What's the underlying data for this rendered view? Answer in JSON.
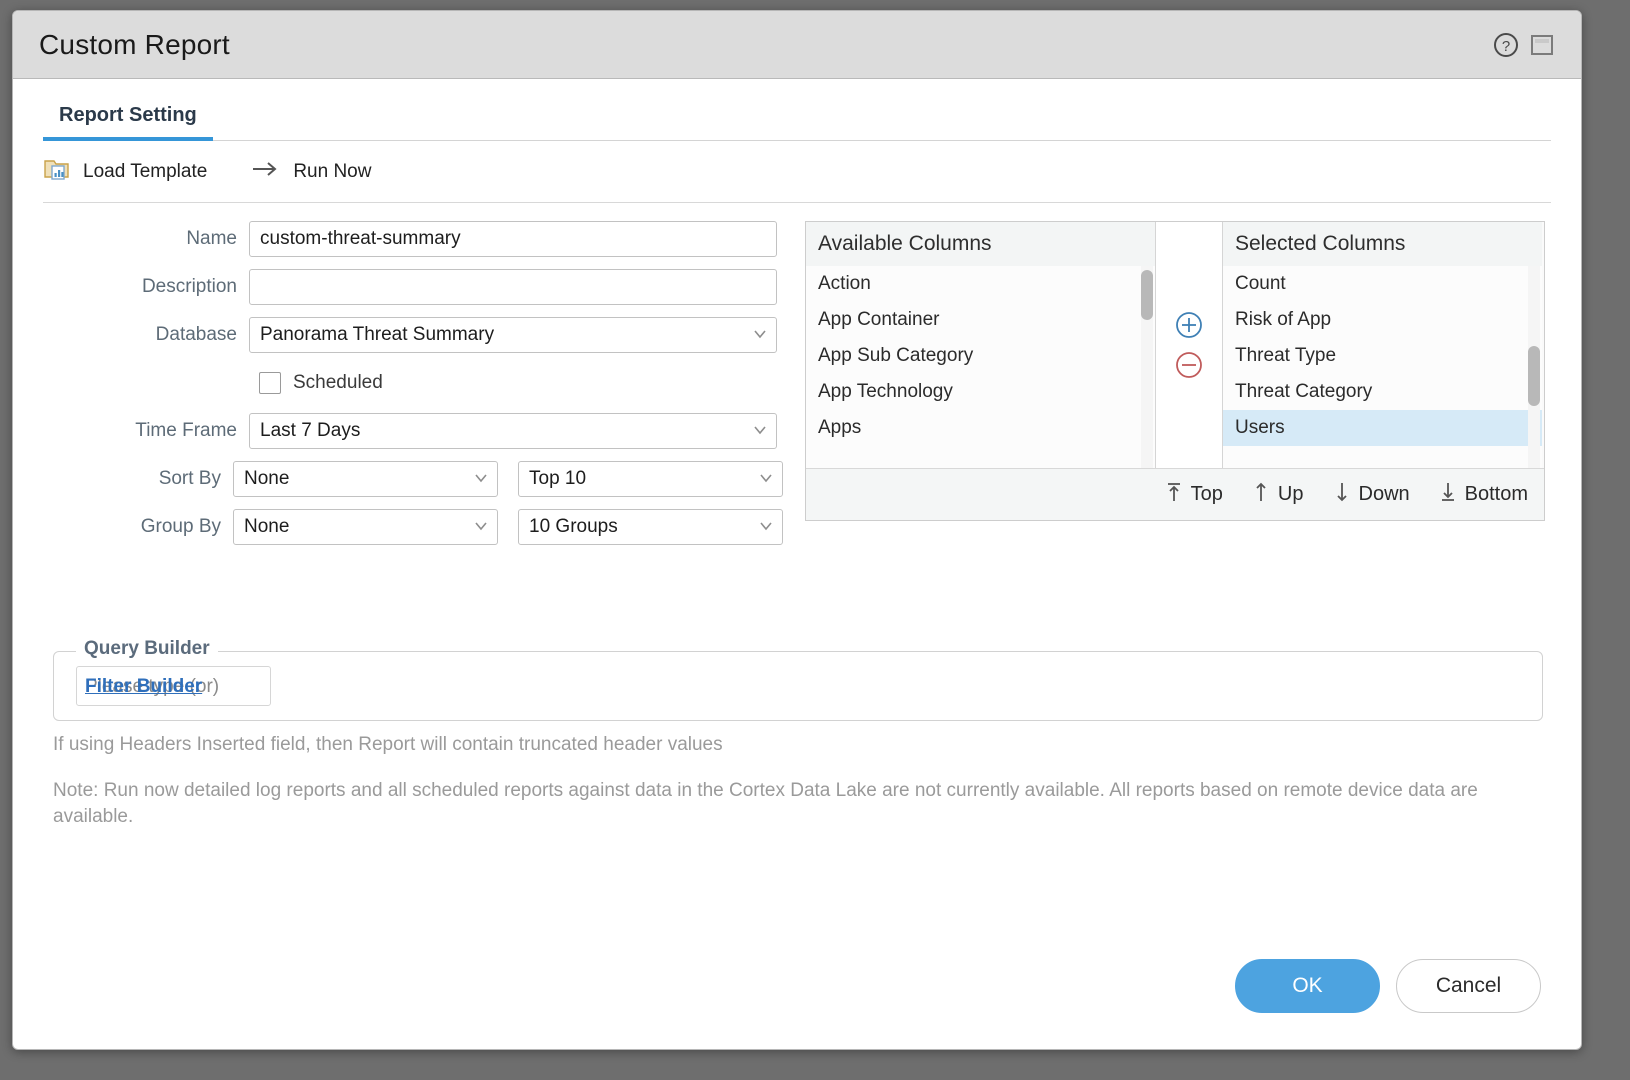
{
  "window": {
    "title": "Custom Report",
    "icons": [
      {
        "name": "help-icon",
        "glyph": "?"
      },
      {
        "name": "window-restore-icon",
        "glyph": "▭"
      }
    ]
  },
  "tabs": [
    {
      "label": "Report Setting",
      "active": true
    }
  ],
  "actionbar": {
    "load_template": "Load Template",
    "run_now": "Run Now"
  },
  "form": {
    "name": {
      "label": "Name",
      "value": "custom-threat-summary",
      "placeholder": ""
    },
    "description": {
      "label": "Description",
      "value": "",
      "placeholder": ""
    },
    "database": {
      "label": "Database",
      "value": "Panorama Threat Summary"
    },
    "scheduled": {
      "label": "Scheduled",
      "checked": false
    },
    "time_frame": {
      "label": "Time Frame",
      "value": "Last 7 Days"
    },
    "sort_by": {
      "label": "Sort By",
      "value": "None",
      "count_value": "Top 10"
    },
    "group_by": {
      "label": "Group By",
      "value": "None",
      "count_value": "10 Groups"
    }
  },
  "columns": {
    "available": {
      "header": "Available Columns",
      "items": [
        "Action",
        "App Container",
        "App Sub Category",
        "App Technology",
        "Apps"
      ]
    },
    "selected": {
      "header": "Selected Columns",
      "items": [
        "Count",
        "Risk of App",
        "Threat Type",
        "Threat Category",
        "Users"
      ],
      "selected_item": "Users"
    },
    "transfer": {
      "add": "add-column-button",
      "remove": "remove-column-button"
    },
    "move_buttons": [
      {
        "label": "Top",
        "icon": "arrow-to-top-icon"
      },
      {
        "label": "Up",
        "icon": "arrow-up-icon"
      },
      {
        "label": "Down",
        "icon": "arrow-down-icon"
      },
      {
        "label": "Bottom",
        "icon": "arrow-to-bottom-icon"
      }
    ]
  },
  "query_builder": {
    "legend": "Query Builder",
    "placeholder": "Please type (or)",
    "link_label": "Filter Builder"
  },
  "hints": {
    "headers_note": "If using Headers Inserted field, then Report will contain truncated header values",
    "cortex_note": "Note: Run now detailed log reports and all scheduled reports against data in the Cortex Data Lake are not currently available. All reports based on remote device data are available."
  },
  "footer": {
    "ok": "OK",
    "cancel": "Cancel"
  },
  "colors": {
    "accent": "#3596d8",
    "primary_button": "#4da3e0",
    "selection": "#d6eaf7",
    "add_icon": "#3f80b5",
    "remove_icon": "#c05b5b",
    "label_text": "#5d6b77"
  }
}
